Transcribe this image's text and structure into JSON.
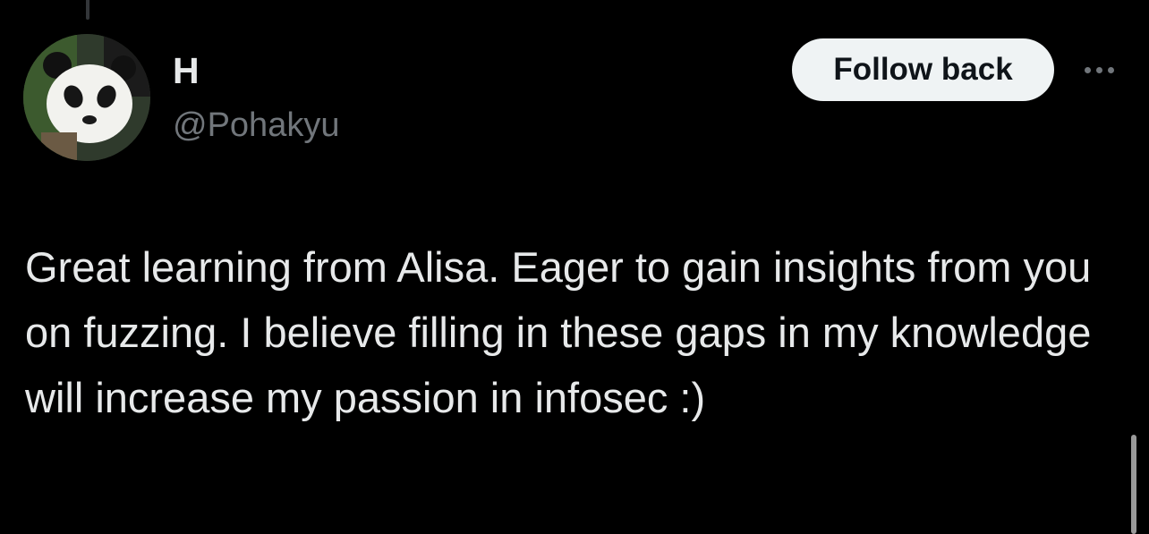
{
  "user": {
    "display_name": "H",
    "handle": "@Pohakyu",
    "avatar_subject": "panda"
  },
  "actions": {
    "follow_label": "Follow back",
    "more_icon": "more-horizontal-icon"
  },
  "tweet": {
    "text": "Great learning from Alisa. Eager to gain insights from you on fuzzing. I believe filling in these gaps in my knowledge will increase my passion in infosec :)"
  },
  "colors": {
    "background": "#000000",
    "primary_text": "#e7e9ea",
    "secondary_text": "#71767b",
    "button_bg": "#eff3f4",
    "button_text": "#0f1419"
  }
}
